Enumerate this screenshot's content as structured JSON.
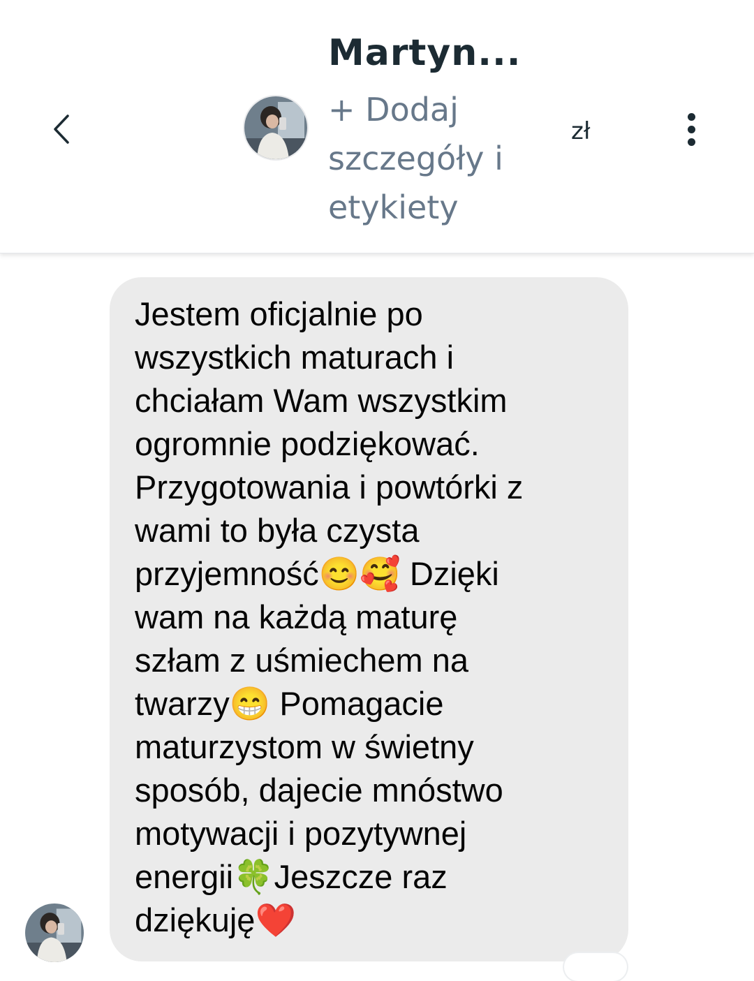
{
  "header": {
    "back_icon": "chevron-left-icon",
    "contact_name": "Martyn...",
    "add_details": "+ Dodaj szczegóły i etykiety",
    "currency": "zł",
    "more_icon": "more-vertical-icon"
  },
  "message": {
    "text": "Jestem oficjalnie po\nwszystkich maturach i\nchciałam Wam wszystkim\nogromnie podziękować.\nPrzygotowania i powtórki z\nwami to była czysta\nprzyjemność😊🥰 Dzięki\nwam na każdą maturę\nszłam z uśmiechem na\ntwarzy😁 Pomagacie\nmaturzystom w świetny\nsposób, dajecie mnóstwo\nmotywacji i pozytywnej\nenergii🍀Jeszcze raz\ndziękuję❤️"
  },
  "colors": {
    "bubble": "#ebebeb",
    "name": "#1c2b33",
    "subtitle": "#67788a"
  }
}
